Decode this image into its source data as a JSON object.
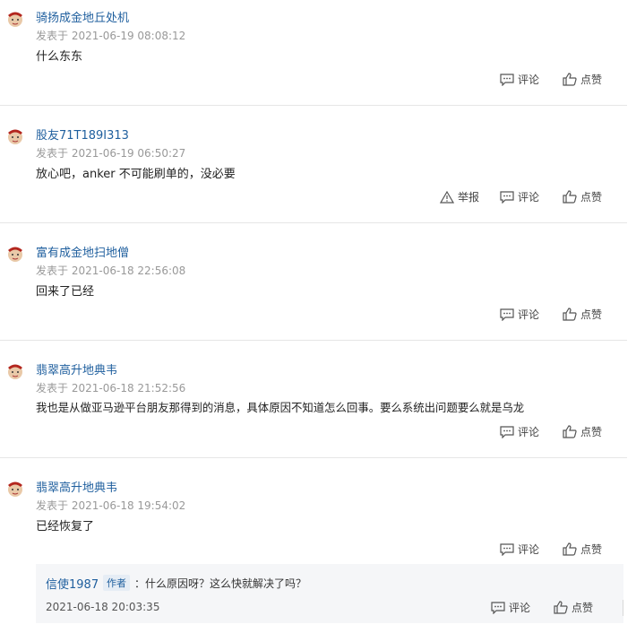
{
  "labels": {
    "posted_prefix": "发表于",
    "comment": "评论",
    "like": "点赞",
    "report": "举报"
  },
  "comments": [
    {
      "user": "骑扬成金地丘处机",
      "time": "2021-06-19 08:08:12",
      "text": "什么东东"
    },
    {
      "user": "股友71T189I313",
      "time": "2021-06-19 06:50:27",
      "text": "放心吧，anker 不可能刷单的，没必要"
    },
    {
      "user": "富有成金地扫地僧",
      "time": "2021-06-18 22:56:08",
      "text": "回来了已经"
    },
    {
      "user": "翡翠高升地典韦",
      "time": "2021-06-18 21:52:56",
      "text": "我也是从做亚马逊平台朋友那得到的消息，具体原因不知道怎么回事。要么系统出问题要么就是乌龙"
    },
    {
      "user": "翡翠高升地典韦",
      "time": "2021-06-18 19:54:02",
      "text": "已经恢复了"
    }
  ],
  "reply": {
    "user": "信使1987",
    "badge": "作者",
    "text": "：什么原因呀？这么快就解决了吗？",
    "time": "2021-06-18 20:03:35"
  }
}
